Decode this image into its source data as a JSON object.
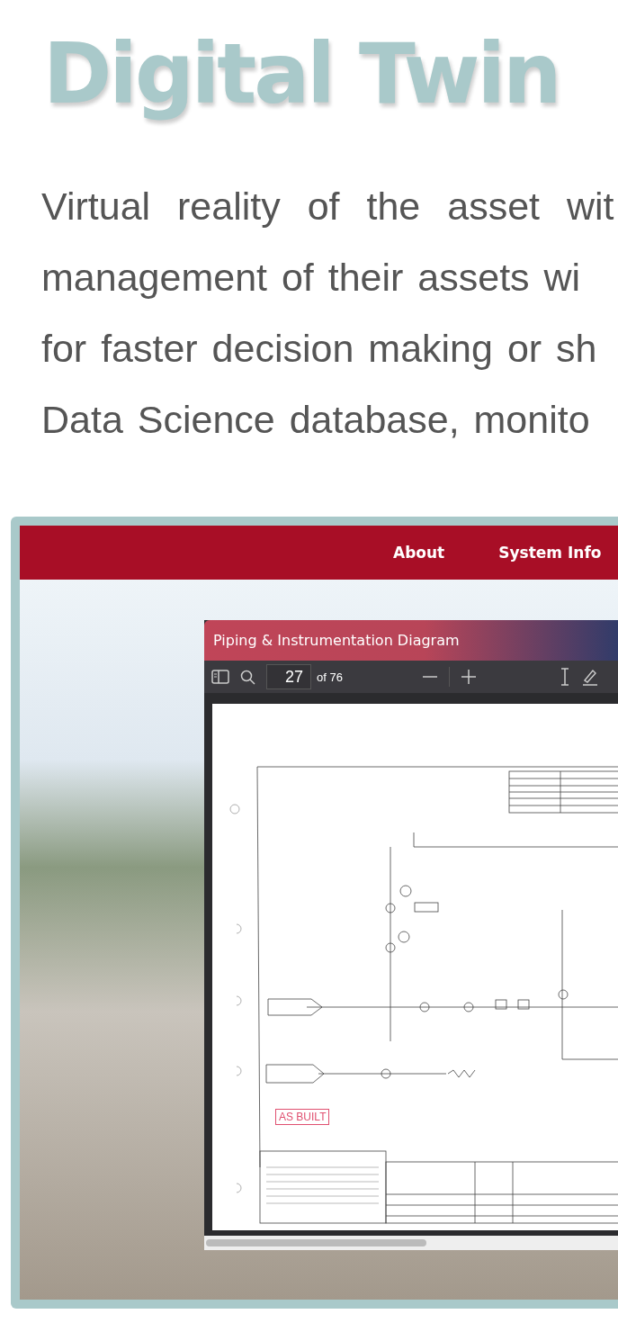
{
  "heading": "Digital Twin",
  "paragraph_lines": [
    "Virtual reality of the asset wit",
    "management of their assets wi",
    "for faster decision making or sh",
    "Data Science database, monito"
  ],
  "nav": {
    "items": [
      {
        "label": "About"
      },
      {
        "label": "System Info"
      }
    ]
  },
  "viewer": {
    "title": "Piping & Instrumentation Diagram",
    "page": "27",
    "page_count": "of 76",
    "stamp": "AS BUILT"
  }
}
